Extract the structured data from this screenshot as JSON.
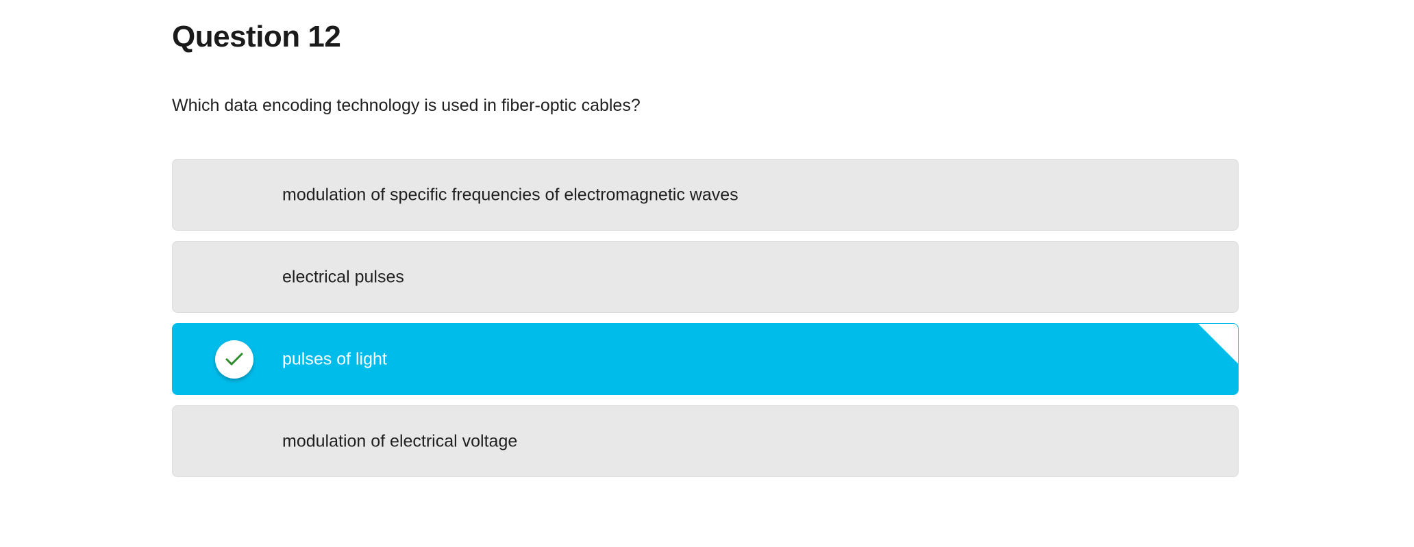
{
  "question": {
    "title": "Question 12",
    "prompt": "Which data encoding technology is used in fiber-optic cables?"
  },
  "options": [
    {
      "label": "modulation of specific frequencies of electromagnetic waves",
      "selected": false
    },
    {
      "label": "electrical pulses",
      "selected": false
    },
    {
      "label": "pulses of light",
      "selected": true,
      "icon": "checkmark-icon"
    },
    {
      "label": "modulation of electrical voltage",
      "selected": false
    }
  ],
  "colors": {
    "selected_background": "#00bceb",
    "option_background": "#e8e8e8",
    "checkmark": "#2e8b2e"
  }
}
